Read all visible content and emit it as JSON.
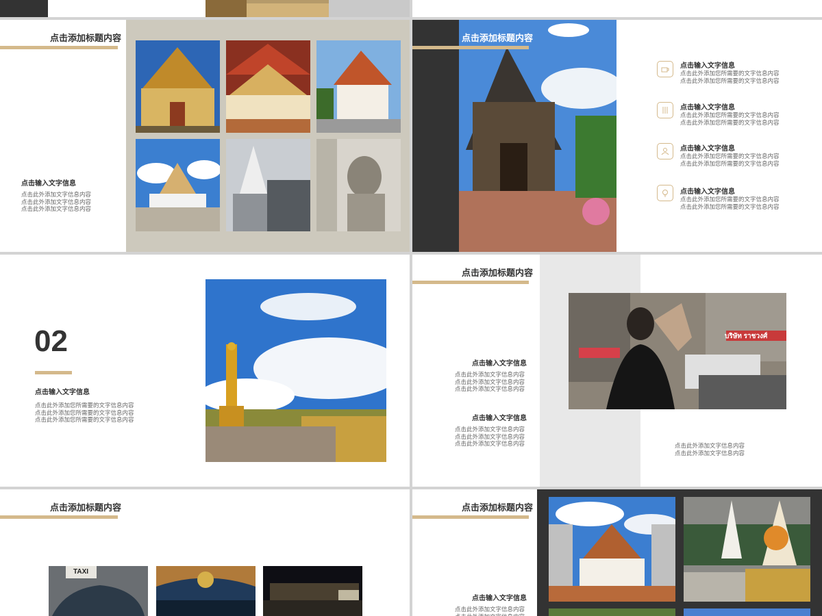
{
  "slide_title": "点击添加标题内容",
  "subtitle": "点击输入文字信息",
  "body_short": "点击此外添加文字信息内容",
  "body_long": "点击此外添加您所需要的文字信息内容",
  "section_number": "02",
  "taxi_sign": "TAXI",
  "shop_sign": "บริษัท ราชวงศ์",
  "colors": {
    "gold": "#d4b98b",
    "dark": "#333333",
    "beige": "#cdc9bd",
    "gray": "#e8e8e8",
    "bg": "#d3d3d3"
  }
}
